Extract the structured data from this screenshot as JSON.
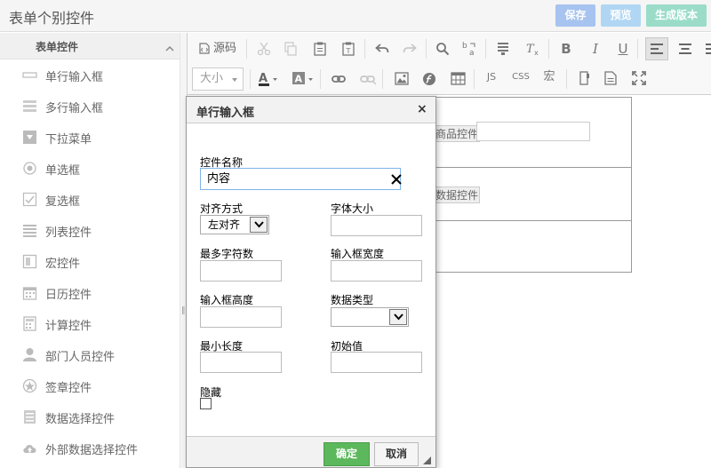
{
  "header": {
    "title": "表单个别控件",
    "save_label": "保存",
    "preview_label": "预览",
    "generate_label": "生成版本"
  },
  "sidebar": {
    "title": "表单控件",
    "items": [
      {
        "label": "单行输入框",
        "icon": "single-line-input-icon"
      },
      {
        "label": "多行输入框",
        "icon": "multi-line-input-icon"
      },
      {
        "label": "下拉菜单",
        "icon": "dropdown-icon"
      },
      {
        "label": "单选框",
        "icon": "radio-icon"
      },
      {
        "label": "复选框",
        "icon": "checkbox-icon"
      },
      {
        "label": "列表控件",
        "icon": "list-icon"
      },
      {
        "label": "宏控件",
        "icon": "macro-icon"
      },
      {
        "label": "日历控件",
        "icon": "calendar-icon"
      },
      {
        "label": "计算控件",
        "icon": "calculator-icon"
      },
      {
        "label": "部门人员控件",
        "icon": "user-icon"
      },
      {
        "label": "签章控件",
        "icon": "seal-icon"
      },
      {
        "label": "数据选择控件",
        "icon": "data-select-icon"
      },
      {
        "label": "外部数据选择控件",
        "icon": "cloud-icon"
      }
    ]
  },
  "toolbar": {
    "source_label": "源码",
    "font_size_placeholder": "大小",
    "js_label": "JS",
    "css_label": "CSS",
    "macro_label": "宏"
  },
  "form": {
    "row1_label": "商品控件",
    "row2_label": "数据控件"
  },
  "dialog": {
    "title": "单行输入框",
    "name_label": "控件名称",
    "name_value": "内容",
    "align_label": "对齐方式",
    "align_value": "左对齐",
    "font_size_label": "字体大小",
    "max_chars_label": "最多字符数",
    "input_width_label": "输入框宽度",
    "input_height_label": "输入框高度",
    "data_type_label": "数据类型",
    "min_length_label": "最小长度",
    "initial_value_label": "初始值",
    "hidden_label": "隐藏",
    "ok_label": "确定",
    "cancel_label": "取消"
  },
  "colors": {
    "save_button": "#a7c3ef",
    "preview_button": "#b1d6f3",
    "generate_button": "#9adcc8",
    "ok_button": "#5cb85c",
    "focus_border": "#7eb4ea"
  }
}
